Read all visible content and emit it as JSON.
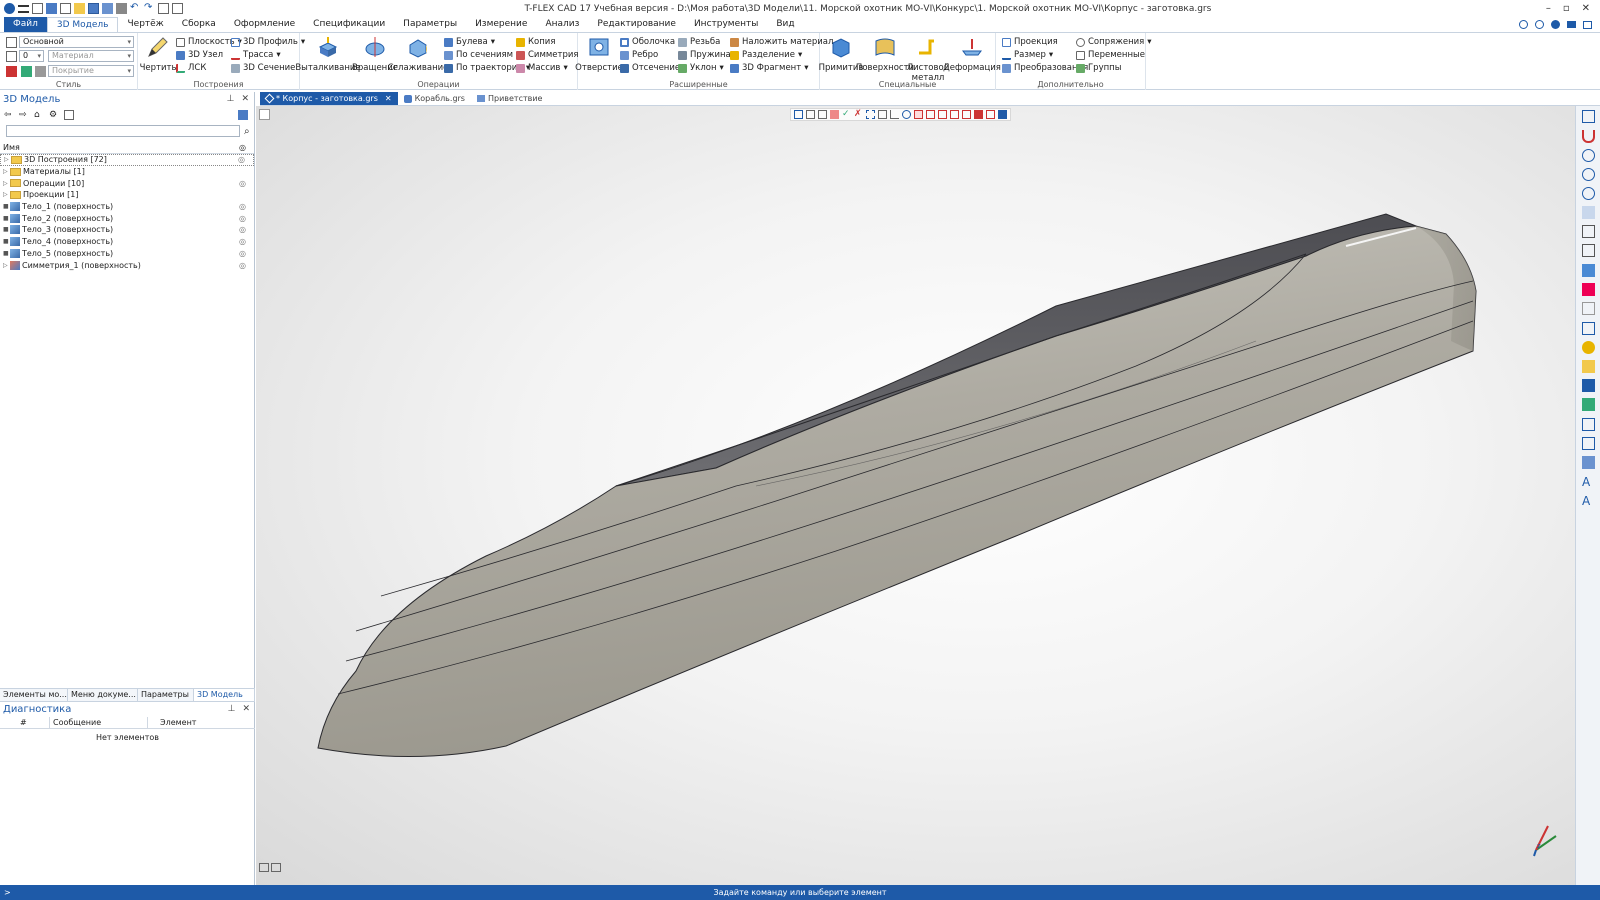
{
  "titlebar": {
    "title": "T-FLEX CAD 17 Учебная версия - D:\\Моя работа\\3D Модели\\11. Морской охотник МО-VI\\Конкурс\\1. Морской охотник МО-VI\\Корпус - заготовка.grs",
    "controls": [
      "–",
      "▫",
      "✕"
    ]
  },
  "menu": {
    "items": [
      "Файл",
      "3D Модель",
      "Чертёж",
      "Сборка",
      "Оформление",
      "Спецификации",
      "Параметры",
      "Измерение",
      "Анализ",
      "Редактирование",
      "Инструменты",
      "Вид"
    ],
    "active": "3D Модель"
  },
  "ribbon": {
    "style": {
      "label": "Стиль",
      "layer": "Основной",
      "level": "0",
      "material_placeholder": "Материал",
      "coating_placeholder": "Покрытие"
    },
    "construct": {
      "label": "Построения",
      "draw": "Чертить",
      "plane": "Плоскость",
      "node": "3D Узел",
      "lcs": "ЛСК",
      "profile": "3D Профиль",
      "path": "Трасса",
      "section": "3D Сечение"
    },
    "operations": {
      "label": "Операции",
      "extrude": "Выталкивание",
      "revolve": "Вращение",
      "smooth": "Сглаживание",
      "boolean": "Булева",
      "loft": "По сечениям",
      "sweep": "По траектории",
      "copy": "Копия",
      "symmetry": "Симметрия",
      "array": "Массив"
    },
    "advanced": {
      "label": "Расширенные",
      "hole": "Отверстие",
      "shell": "Оболочка",
      "rib": "Ребро",
      "cut": "Отсечение",
      "thread": "Резьба",
      "spring": "Пружина",
      "draft": "Уклон",
      "apply_material": "Наложить материал",
      "split": "Разделение",
      "fragment": "3D Фрагмент"
    },
    "special": {
      "label": "Специальные",
      "primitive": "Примитив",
      "surfaces": "Поверхности",
      "sheet_metal": "Листовой металл",
      "deformation": "Деформация"
    },
    "extra": {
      "label": "Дополнительно",
      "projection": "Проекция",
      "dimension": "Размер",
      "transform": "Преобразования",
      "mates": "Сопряжения",
      "variables": "Переменные",
      "groups": "Группы"
    }
  },
  "doctabs": [
    {
      "label": "* Корпус - заготовка.grs",
      "active": true
    },
    {
      "label": "Корабль.grs",
      "active": false
    },
    {
      "label": "Приветствие",
      "active": false
    }
  ],
  "model_panel": {
    "title": "3D Модель",
    "column_name": "Имя",
    "tree": [
      {
        "label": "3D Построения [72]",
        "type": "folder",
        "eye": true,
        "selected": true
      },
      {
        "label": "Материалы [1]",
        "type": "folder",
        "eye": false
      },
      {
        "label": "Операции [10]",
        "type": "folder",
        "eye": true
      },
      {
        "label": "Проекции [1]",
        "type": "folder",
        "eye": false
      },
      {
        "label": "Тело_1 (поверхность)",
        "type": "body",
        "eye": true
      },
      {
        "label": "Тело_2 (поверхность)",
        "type": "body",
        "eye": true
      },
      {
        "label": "Тело_3 (поверхность)",
        "type": "body",
        "eye": true
      },
      {
        "label": "Тело_4 (поверхность)",
        "type": "body",
        "eye": true
      },
      {
        "label": "Тело_5 (поверхность)",
        "type": "body",
        "eye": true
      },
      {
        "label": "Симметрия_1 (поверхность)",
        "type": "sym",
        "eye": true
      }
    ],
    "tabs": [
      "Элементы мо...",
      "Меню докуме...",
      "Параметры",
      "3D Модель"
    ]
  },
  "diagnostics": {
    "title": "Диагностика",
    "col_num": "#",
    "col_msg": "Сообщение",
    "col_elem": "Элемент",
    "empty": "Нет элементов"
  },
  "status": {
    "lead": ">",
    "text": "Задайте команду или выберите элемент"
  },
  "colors": {
    "accent": "#1e5aa8",
    "hull_side": "#a9a69c",
    "hull_deck": "#5d5d63"
  }
}
